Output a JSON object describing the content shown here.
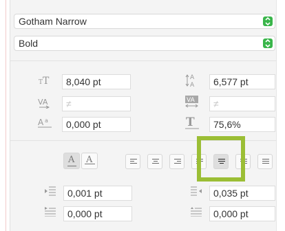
{
  "font": {
    "family": "Gotham Narrow",
    "style": "Bold"
  },
  "metrics": {
    "size": "8,040 pt",
    "leading": "6,577 pt",
    "kerning": "≠",
    "tracking": "≠",
    "baseline_shift": "0,000 pt",
    "horizontal_scale": "75,6%"
  },
  "indent": {
    "left": "0,001 pt",
    "right": "0,035 pt",
    "first_line": "0,000 pt",
    "space_before": "0,000 pt"
  },
  "glyphs": {
    "char_a": "A"
  },
  "colors": {
    "accent_green": "#39b54a",
    "highlight": "#9bbe35"
  }
}
